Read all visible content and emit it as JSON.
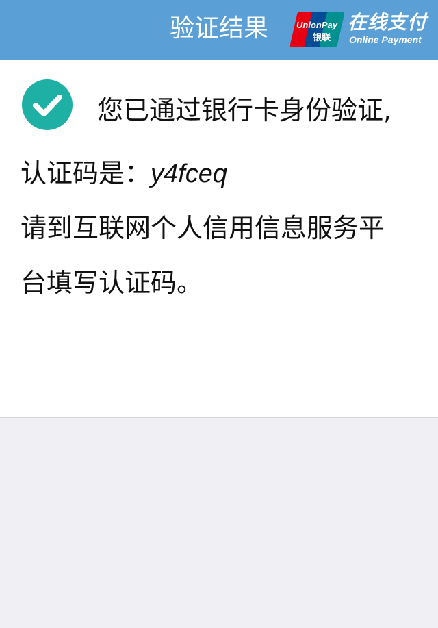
{
  "header": {
    "title": "验证结果",
    "logo": {
      "brand_en": "UnionPay",
      "brand_cn": "银联",
      "tagline_cn": "在线支付",
      "tagline_en": "Online  Payment",
      "colors": [
        "#e60012",
        "#004c97",
        "#00908f"
      ]
    }
  },
  "result": {
    "status_icon": "check-circle-icon",
    "line1": "您已通过银行卡身份验证,",
    "code_label": "认证码是：",
    "code_value": "y4fceq",
    "line3": "请到互联网个人信用信息服务平",
    "line4": "台填写认证码。"
  },
  "colors": {
    "header_bg": "#5a9fd6",
    "check": "#1fb0a5",
    "body_bg": "#efeff4"
  }
}
